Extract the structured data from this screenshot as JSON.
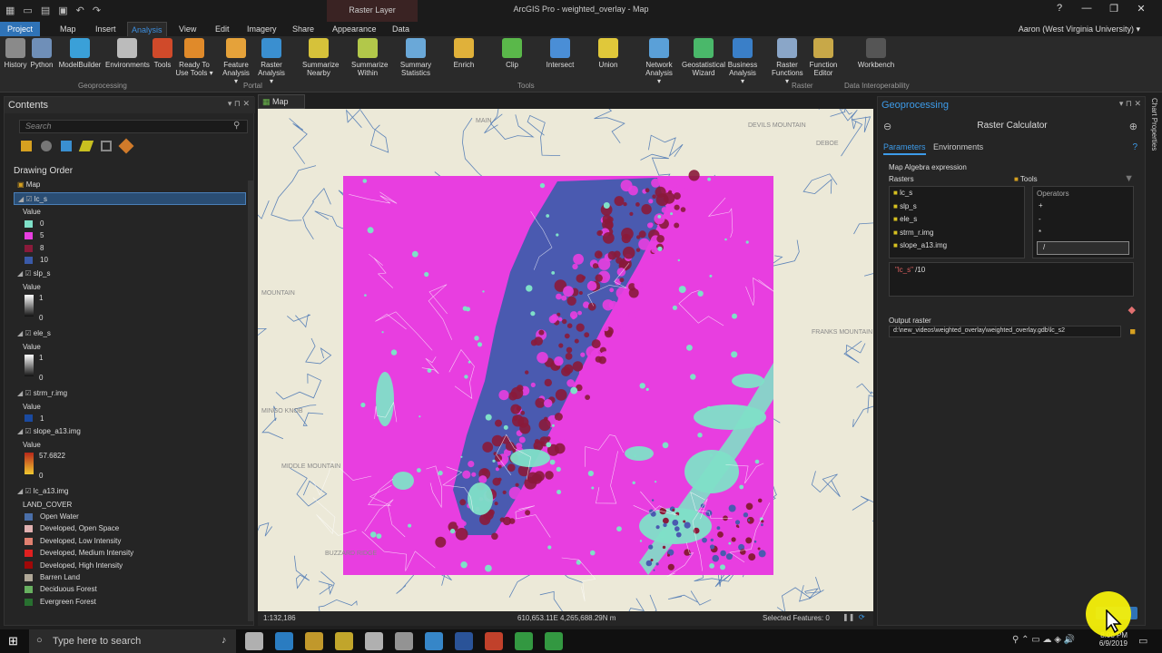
{
  "app": {
    "title": "ArcGIS Pro - weighted_overlay - Map",
    "context_tab": "Raster Layer"
  },
  "window_controls": [
    "?",
    "—",
    "❐",
    "✕"
  ],
  "tabs": [
    "Project",
    "Map",
    "Insert",
    "Analysis",
    "View",
    "Edit",
    "Imagery",
    "Share",
    "Appearance",
    "Data"
  ],
  "user": "Aaron (West Virginia University) ▾",
  "ribbon": {
    "buttons": [
      {
        "label": "History",
        "color": "#8a8a8a"
      },
      {
        "label": "Python",
        "color": "#6f8fb8"
      },
      {
        "label": "ModelBuilder",
        "color": "#3aa0d8"
      },
      {
        "label": "Environments",
        "color": "#bbbbbb"
      },
      {
        "label": "Tools",
        "color": "#d04a2a"
      },
      {
        "label": "Ready To Use Tools ▾",
        "color": "#e08a2a"
      },
      {
        "label": "Feature Analysis ▾",
        "color": "#e5a23a"
      },
      {
        "label": "Raster Analysis ▾",
        "color": "#3a8fd0"
      },
      {
        "label": "Summarize Nearby",
        "color": "#d6c23a"
      },
      {
        "label": "Summarize Within",
        "color": "#b2c84a"
      },
      {
        "label": "Summary Statistics",
        "color": "#6aa8d8"
      },
      {
        "label": "Enrich",
        "color": "#e0b13a"
      },
      {
        "label": "Clip",
        "color": "#5ab84a"
      },
      {
        "label": "Intersect",
        "color": "#4a8ed6"
      },
      {
        "label": "Union",
        "color": "#e0c83a"
      },
      {
        "label": "Network Analysis ▾",
        "color": "#5aa0d8"
      },
      {
        "label": "Geostatistical Wizard",
        "color": "#4ab86a"
      },
      {
        "label": "Business Analysis ▾",
        "color": "#3a7fc8"
      },
      {
        "label": "Raster Functions ▾",
        "color": "#8aa6c8"
      },
      {
        "label": "Function Editor",
        "color": "#c8a848"
      },
      {
        "label": "Workbench",
        "color": "#555555"
      }
    ],
    "groups": [
      "Geoprocessing",
      "Portal",
      "Tools",
      "Raster",
      "Data Interoperability"
    ]
  },
  "contents": {
    "title": "Contents",
    "search_placeholder": "Search",
    "drawing_order": "Drawing Order",
    "items": [
      {
        "type": "map",
        "text": "Map"
      },
      {
        "type": "layer",
        "text": "lc_s",
        "selected": true
      },
      {
        "type": "label",
        "text": "Value"
      },
      {
        "type": "sw",
        "text": "0",
        "color": "#7fe0c8"
      },
      {
        "type": "sw",
        "text": "5",
        "color": "#e83ee0"
      },
      {
        "type": "sw",
        "text": "8",
        "color": "#8a1a3a"
      },
      {
        "type": "sw",
        "text": "10",
        "color": "#3a5aa8"
      },
      {
        "type": "layer",
        "text": "slp_s"
      },
      {
        "type": "label",
        "text": "Value"
      },
      {
        "type": "grad",
        "hi": "1",
        "lo": "0",
        "colors": "#ffffff,#111111"
      },
      {
        "type": "layer",
        "text": "ele_s"
      },
      {
        "type": "label",
        "text": "Value"
      },
      {
        "type": "grad",
        "hi": "1",
        "lo": "0",
        "colors": "#ffffff,#111111"
      },
      {
        "type": "layer",
        "text": "strm_r.img"
      },
      {
        "type": "label",
        "text": "Value"
      },
      {
        "type": "sw",
        "text": "1",
        "color": "#1a4aa0"
      },
      {
        "type": "layer",
        "text": "slope_a13.img"
      },
      {
        "type": "label",
        "text": "Value"
      },
      {
        "type": "grad",
        "hi": "57.6822",
        "lo": "0",
        "colors": "#b8281a,#f0c830"
      },
      {
        "type": "layer",
        "text": "lc_a13.img"
      },
      {
        "type": "label",
        "text": "LAND_COVER"
      },
      {
        "type": "sw",
        "text": "Open Water",
        "color": "#4a6ea8"
      },
      {
        "type": "sw",
        "text": "Developed, Open Space",
        "color": "#e0b0b0"
      },
      {
        "type": "sw",
        "text": "Developed, Low Intensity",
        "color": "#e08070"
      },
      {
        "type": "sw",
        "text": "Developed, Medium Intensity",
        "color": "#e02020"
      },
      {
        "type": "sw",
        "text": "Developed, High Intensity",
        "color": "#a00808"
      },
      {
        "type": "sw",
        "text": "Barren Land",
        "color": "#b0a898"
      },
      {
        "type": "sw",
        "text": "Deciduous Forest",
        "color": "#68b060"
      },
      {
        "type": "sw",
        "text": "Evergreen Forest",
        "color": "#287030"
      }
    ]
  },
  "map": {
    "tab": "Map",
    "labels": [
      "MAIN",
      "MINGO KNOB",
      "MIDDLE MOUNTAIN",
      "BUZZARD RIDGE",
      "DEVILS MOUNTAIN",
      "FRANKS MOUNTAIN",
      "MOUNTAIN",
      "DEBOE"
    ],
    "colors": {
      "base": "#ece9d8",
      "magenta": "#e83ee0",
      "maroon": "#8a1a3a",
      "blue": "#4a5ab0",
      "teal": "#7fe0c8",
      "stream": "#3a6ab0"
    }
  },
  "status": {
    "scale": "1:132,186",
    "coords": "610,653.11E 4,265,688.29N m",
    "selected": "Selected Features: 0"
  },
  "geoprocessing": {
    "title": "Geoprocessing",
    "tool": "Raster Calculator",
    "tabs": [
      "Parameters",
      "Environments"
    ],
    "expr_label": "Map Algebra expression",
    "rasters_label": "Rasters",
    "tools_label": "Tools",
    "operators_label": "Operators",
    "rasters": [
      "lc_s",
      "slp_s",
      "ele_s",
      "strm_r.img",
      "slope_a13.img"
    ],
    "operators": [
      "+",
      "-",
      "*",
      "/"
    ],
    "expression_name": "\"lc_s\"",
    "expression_rest": " /10",
    "output_label": "Output raster",
    "output_value": "d:\\new_videos\\weighted_overlay\\weighted_overlay.gdb\\lc_s2"
  },
  "sidebar": {
    "label": "Chart Properties"
  },
  "taskbar": {
    "search_placeholder": "Type here to search",
    "time": "8:08 PM",
    "date": "6/9/2019"
  }
}
